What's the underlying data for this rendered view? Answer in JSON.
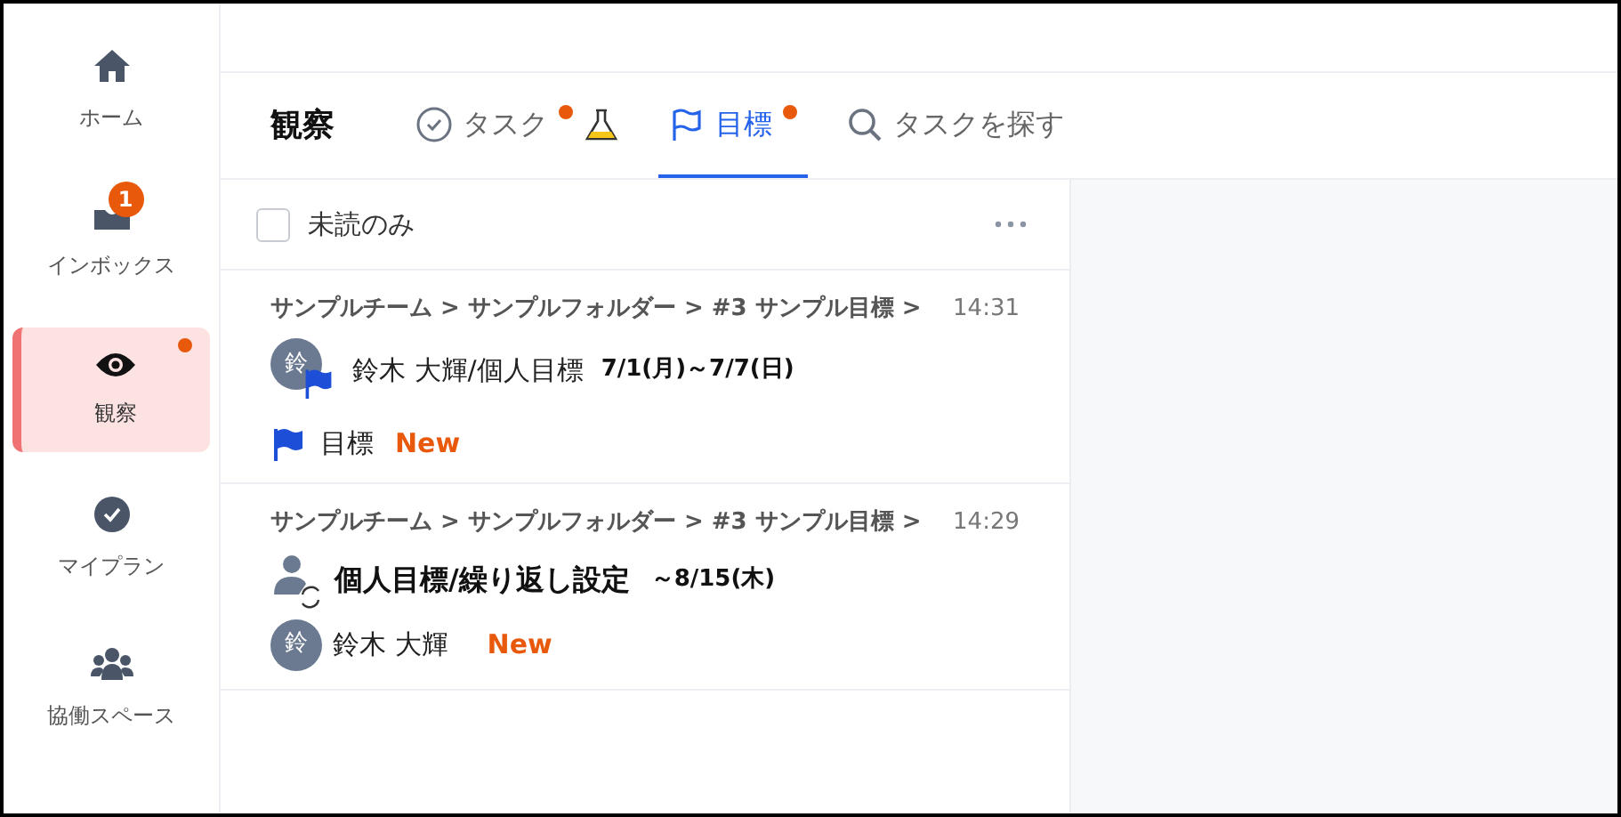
{
  "sidebar": {
    "items": [
      {
        "kind": "home",
        "label": "ホーム",
        "selected": false,
        "dot": false
      },
      {
        "kind": "inbox",
        "label": "インボックス",
        "selected": false,
        "dot": false,
        "badge": "1"
      },
      {
        "kind": "watch",
        "label": "観察",
        "selected": true,
        "dot": true
      },
      {
        "kind": "plan",
        "label": "マイプラン",
        "selected": false,
        "dot": false
      },
      {
        "kind": "space",
        "label": "協働スペース",
        "selected": false,
        "dot": false
      }
    ]
  },
  "header": {
    "title": "観察",
    "tabs": [
      {
        "kind": "task",
        "label": "タスク",
        "selected": false,
        "dot": true,
        "flask": true
      },
      {
        "kind": "goal",
        "label": "目標",
        "selected": true,
        "dot": true,
        "flask": false
      },
      {
        "kind": "search",
        "label": "タスクを探す",
        "selected": false,
        "dot": false,
        "flask": false
      }
    ]
  },
  "filter": {
    "label": "未読のみ",
    "checked": false
  },
  "items": [
    {
      "kind": "goal",
      "breadcrumb": "サンプルチーム > サンプルフォルダー > #3 サンプル目標 >",
      "time": "14:31",
      "avatar": "鈴",
      "title": "鈴木 大輝/個人目標",
      "date": "7/1(月)～7/7(日)",
      "footer": "目標",
      "badge": "New"
    },
    {
      "kind": "recurring",
      "breadcrumb": "サンプルチーム > サンプルフォルダー > #3 サンプル目標 >",
      "time": "14:29",
      "avatar": "鈴",
      "title": "個人目標/繰り返し設定",
      "date": "～8/15(木)",
      "footer": "鈴木 大輝",
      "badge": "New"
    }
  ]
}
